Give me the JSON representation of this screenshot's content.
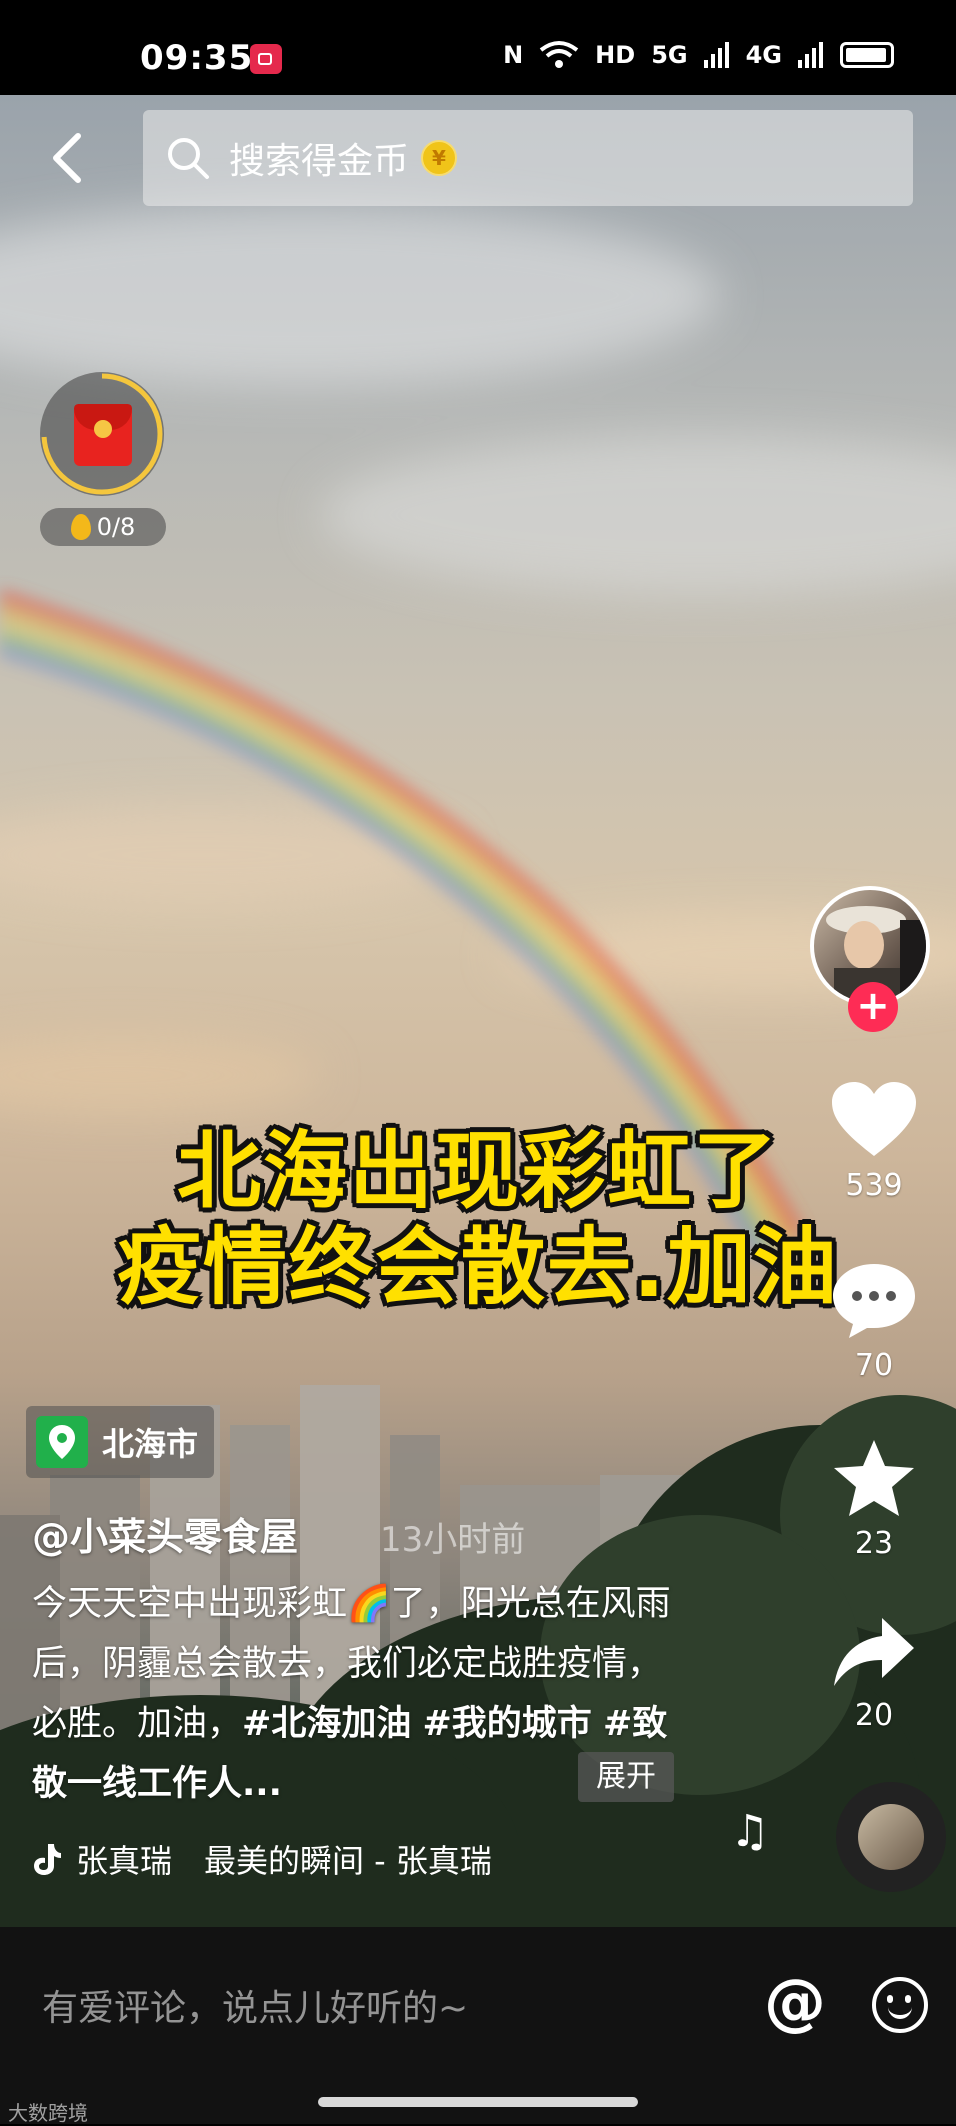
{
  "status_bar": {
    "time": "09:35",
    "network_labels": [
      "HD",
      "5G",
      "4G"
    ]
  },
  "header": {
    "search_placeholder": "搜索得金币",
    "coin_glyph": "¥"
  },
  "reward": {
    "progress": "0/8"
  },
  "video": {
    "overlay_line1": "北海出现彩虹了",
    "overlay_line2": "疫情终会散去.加油"
  },
  "actions": {
    "likes": "539",
    "comments": "70",
    "favorites": "23",
    "shares": "20",
    "follow_symbol": "+"
  },
  "post": {
    "location": "北海市",
    "author": "@小菜头零食屋",
    "time_ago": "13小时前",
    "description": "今天天空中出现彩虹🌈了，阳光总在风雨后，阴霾总会散去，我们必定战胜疫情，必胜。加油，",
    "tag1": "#北海加油",
    "tag2": "#我的城市",
    "tag3": "#致敬一线工作人...",
    "expand_label": "展开",
    "music": "张真瑞　最美的瞬间 - 张真瑞"
  },
  "comment_bar": {
    "placeholder": "有爱评论，说点儿好听的~",
    "at_symbol": "@",
    "watermark": "大数跨境"
  },
  "colors": {
    "accent_red": "#fe2c55",
    "title_yellow": "#ffe000",
    "location_green": "#21b04b"
  }
}
